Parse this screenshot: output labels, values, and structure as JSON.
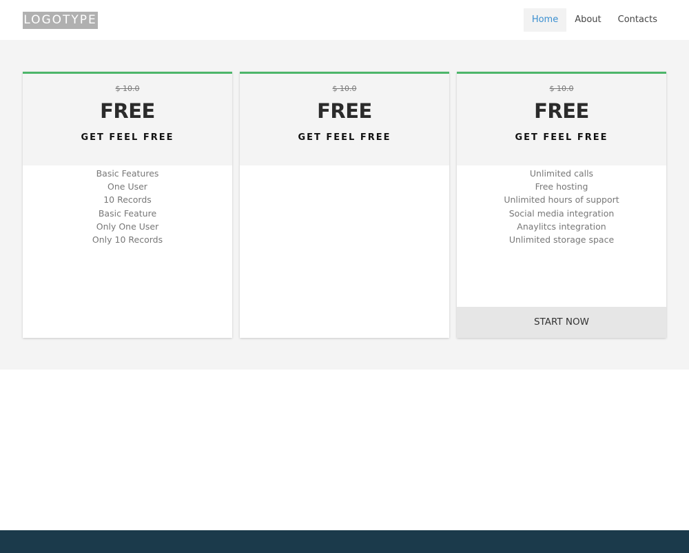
{
  "header": {
    "logo_text": "LOGOTYPE",
    "nav": [
      {
        "label": "Home",
        "active": true
      },
      {
        "label": "About",
        "active": false
      },
      {
        "label": "Contacts",
        "active": false
      }
    ]
  },
  "colors": {
    "accent_border": "#4cb56a",
    "nav_active_text": "#3a8fd0",
    "footer": "#1b3a4b",
    "band_background": "#f4f4f4"
  },
  "plans": [
    {
      "old_price": "$ 10.0",
      "price": "FREE",
      "name": "GET FEEL FREE",
      "features": [
        "Basic Features",
        "One User",
        "10 Records",
        "Basic Feature",
        "Only One User",
        "Only 10 Records"
      ]
    },
    {
      "old_price": "$ 10.0",
      "price": "FREE",
      "name": "GET FEEL FREE",
      "features": []
    },
    {
      "old_price": "$ 10.0",
      "price": "FREE",
      "name": "GET FEEL FREE",
      "features": [
        "Unlimited calls",
        "Free hosting",
        "Unlimited hours of support",
        "Social media integration",
        "Anaylitcs integration",
        "Unlimited storage space"
      ],
      "cta_label": "START NOW"
    }
  ]
}
